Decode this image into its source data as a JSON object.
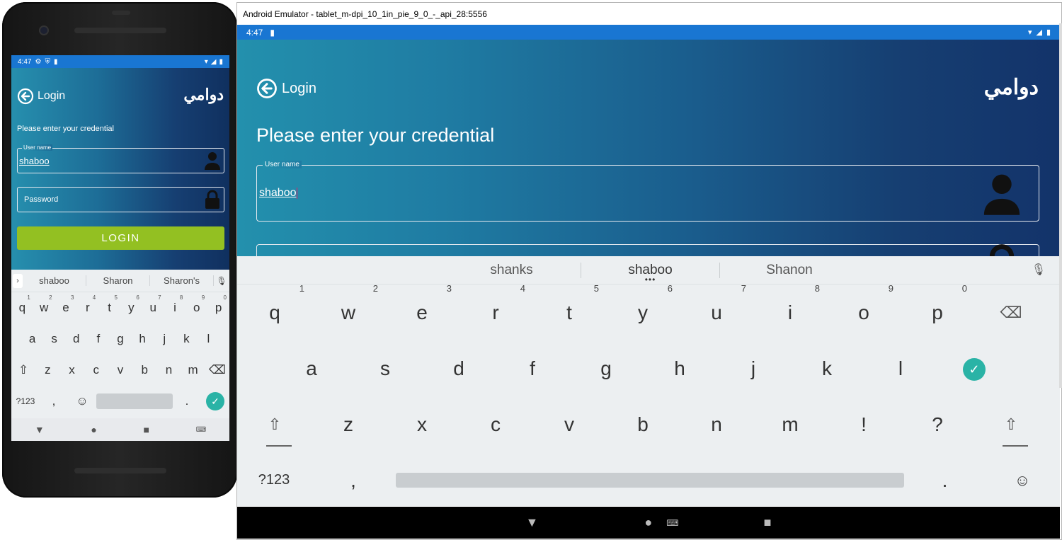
{
  "window": {
    "title": "Android Emulator - tablet_m-dpi_10_1in_pie_9_0_-_api_28:5556"
  },
  "phone": {
    "status": {
      "time": "4:47"
    },
    "header": {
      "back_label": "Login",
      "logo": "دوامي"
    },
    "prompt": "Please enter your credential",
    "username": {
      "legend": "User name",
      "value": "shaboo"
    },
    "password": {
      "placeholder": "Password"
    },
    "login_button": "LOGIN",
    "keyboard": {
      "suggestions": [
        "shaboo",
        "Sharon",
        "Sharon's"
      ],
      "row1": [
        {
          "k": "q",
          "n": "1"
        },
        {
          "k": "w",
          "n": "2"
        },
        {
          "k": "e",
          "n": "3"
        },
        {
          "k": "r",
          "n": "4"
        },
        {
          "k": "t",
          "n": "5"
        },
        {
          "k": "y",
          "n": "6"
        },
        {
          "k": "u",
          "n": "7"
        },
        {
          "k": "i",
          "n": "8"
        },
        {
          "k": "o",
          "n": "9"
        },
        {
          "k": "p",
          "n": "0"
        }
      ],
      "row2": [
        "a",
        "s",
        "d",
        "f",
        "g",
        "h",
        "j",
        "k",
        "l"
      ],
      "row3": [
        "z",
        "x",
        "c",
        "v",
        "b",
        "n",
        "m"
      ],
      "symbols": "?123",
      "comma": ",",
      "period": "."
    }
  },
  "tablet": {
    "status": {
      "time": "4:47"
    },
    "header": {
      "back_label": "Login",
      "logo": "دوامي"
    },
    "prompt": "Please enter your credential",
    "username": {
      "legend": "User name",
      "value": "shaboo"
    },
    "keyboard": {
      "suggestions": [
        "shanks",
        "shaboo",
        "Shanon"
      ],
      "row1": [
        {
          "k": "q",
          "n": "1"
        },
        {
          "k": "w",
          "n": "2"
        },
        {
          "k": "e",
          "n": "3"
        },
        {
          "k": "r",
          "n": "4"
        },
        {
          "k": "t",
          "n": "5"
        },
        {
          "k": "y",
          "n": "6"
        },
        {
          "k": "u",
          "n": "7"
        },
        {
          "k": "i",
          "n": "8"
        },
        {
          "k": "o",
          "n": "9"
        },
        {
          "k": "p",
          "n": "0"
        }
      ],
      "row2": [
        "a",
        "s",
        "d",
        "f",
        "g",
        "h",
        "j",
        "k",
        "l"
      ],
      "row3": [
        "z",
        "x",
        "c",
        "v",
        "b",
        "n",
        "m",
        "!",
        "?"
      ],
      "symbols": "?123",
      "comma": ",",
      "period": "."
    }
  },
  "colors": {
    "status_bar": "#1976d2",
    "login_button": "#93c022",
    "done_key": "#2ab3a6",
    "gradient_start": "#2390ad",
    "gradient_end": "#13336a"
  }
}
